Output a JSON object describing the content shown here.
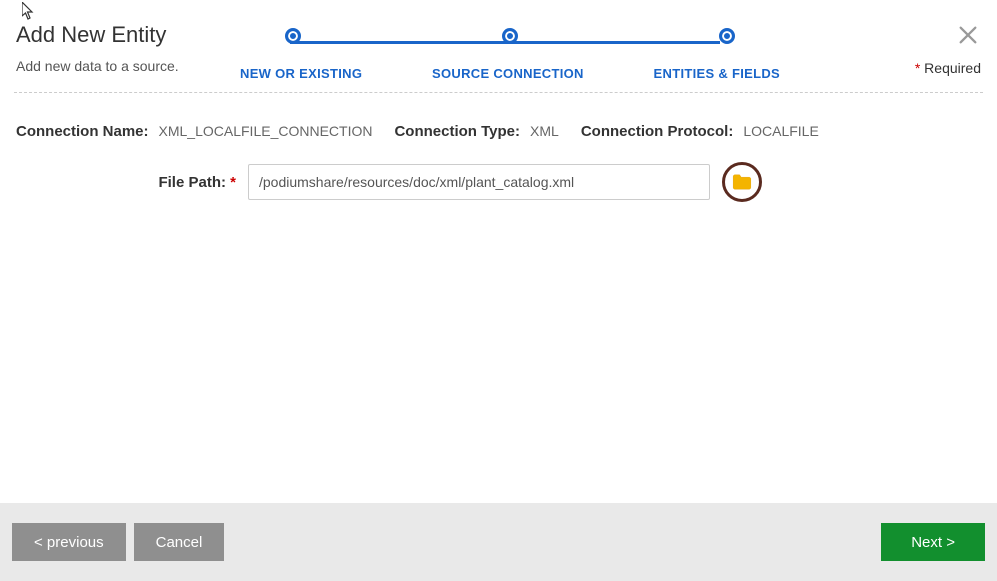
{
  "header": {
    "title": "Add New Entity",
    "subtitle": "Add new data to a source.",
    "required_label": "Required"
  },
  "stepper": {
    "steps": [
      "NEW OR EXISTING",
      "SOURCE CONNECTION",
      "ENTITIES & FIELDS"
    ]
  },
  "connection": {
    "name_label": "Connection Name:",
    "name_value": "XML_LOCALFILE_CONNECTION",
    "type_label": "Connection Type:",
    "type_value": "XML",
    "protocol_label": "Connection Protocol:",
    "protocol_value": "LOCALFILE"
  },
  "file_path": {
    "label": "File Path:",
    "value": "/podiumshare/resources/doc/xml/plant_catalog.xml"
  },
  "footer": {
    "previous": "< previous",
    "cancel": "Cancel",
    "next": "Next >"
  }
}
